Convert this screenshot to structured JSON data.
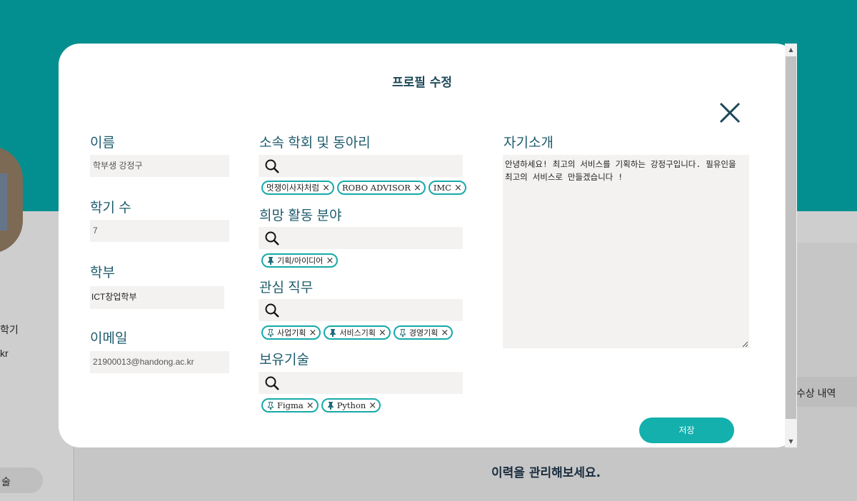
{
  "background": {
    "side_text_semester": "학기",
    "side_text_email": "kr",
    "side_pill": "술",
    "tab_awards": "수상 내역",
    "cta": "이력을 관리해보세요."
  },
  "modal": {
    "title": "프로필 수정",
    "name": {
      "label": "이름",
      "value": "학부생 강정구"
    },
    "semester": {
      "label": "학기 수",
      "value": "7"
    },
    "department": {
      "label": "학부",
      "value": "ICT창업학부"
    },
    "email": {
      "label": "이메일",
      "value": "21900013@handong.ac.kr"
    },
    "clubs": {
      "label": "소속 학회 및 동아리",
      "tags": [
        "멋쟁이사자처럼",
        "ROBO ADVISOR",
        "IMC"
      ]
    },
    "interests": {
      "label": "희망 활동 분야",
      "tags": [
        "기획/아이디어"
      ]
    },
    "jobs": {
      "label": "관심 직무",
      "tags": [
        "사업기획",
        "서비스기획",
        "경영기획"
      ]
    },
    "skills": {
      "label": "보유기술",
      "tags": [
        "Figma",
        "Python"
      ]
    },
    "intro": {
      "label": "자기소개",
      "value": "안녕하세요! 최고의 서비스를 기획하는 강정구입니다. 필유인을 최고의 서비스로 만들겠습니다 !"
    },
    "save_label": "저장"
  },
  "colors": {
    "header_bg": "#038f8f",
    "accent": "#13b0ad",
    "label_text": "#1c5b6c"
  }
}
